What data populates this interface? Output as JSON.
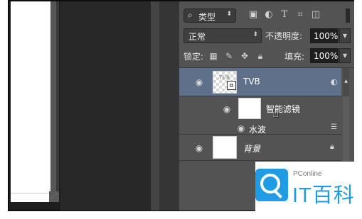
{
  "layers_panel": {
    "filter": {
      "kind_label": "类型",
      "icons": [
        "image-filter-icon",
        "adjustment-filter-icon",
        "text-filter-icon",
        "shape-filter-icon",
        "smart-object-filter-icon"
      ]
    },
    "blend_mode": "正常",
    "opacity_label": "不透明度:",
    "opacity_value": "100%",
    "lock_label": "锁定:",
    "fill_label": "填充:",
    "fill_value": "100%",
    "layers": [
      {
        "name": "TVB",
        "thumb_text": "TVB",
        "selected": true,
        "type": "smart-object"
      },
      {
        "name": "智能滤镜",
        "type": "smart-filter-mask"
      },
      {
        "name": "水波",
        "type": "filter-effect"
      },
      {
        "name": "背景",
        "type": "background",
        "locked": true
      }
    ]
  },
  "watermark": {
    "brand": "PConline",
    "title": "IT百科"
  }
}
